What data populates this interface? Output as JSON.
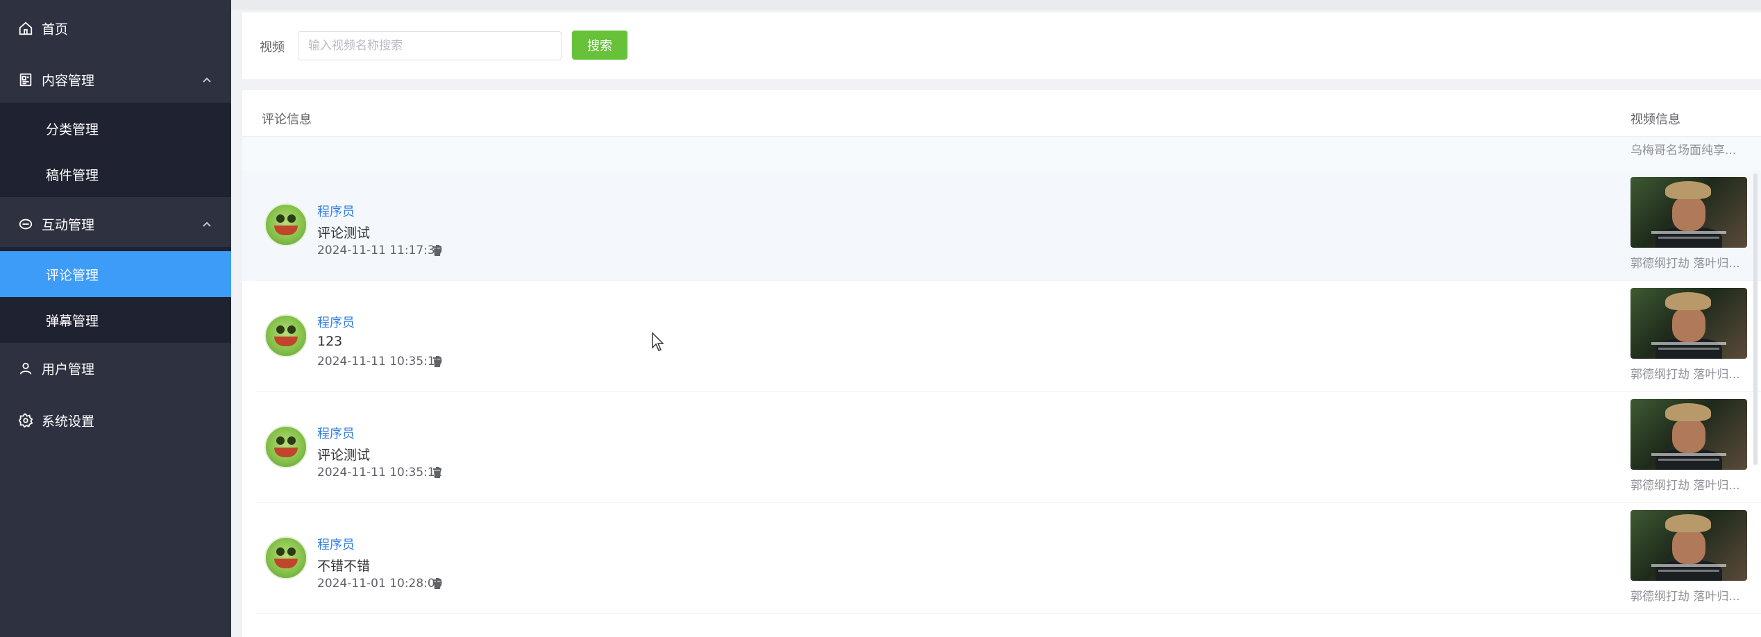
{
  "sidebar": {
    "items": [
      {
        "label": "首页",
        "icon": "home-icon"
      },
      {
        "label": "内容管理",
        "icon": "document-icon",
        "expanded": true
      },
      {
        "label": "分类管理"
      },
      {
        "label": "稿件管理"
      },
      {
        "label": "互动管理",
        "icon": "chat-icon",
        "expanded": true
      },
      {
        "label": "评论管理",
        "active": true
      },
      {
        "label": "弹幕管理"
      },
      {
        "label": "用户管理",
        "icon": "user-icon"
      },
      {
        "label": "系统设置",
        "icon": "gear-icon"
      }
    ]
  },
  "search": {
    "label": "视频",
    "placeholder": "输入视频名称搜索",
    "value": "",
    "button_label": "搜索"
  },
  "table": {
    "headers": {
      "comment": "评论信息",
      "video": "视频信息"
    },
    "partial_row_video_title": "乌梅哥名场面纯享...",
    "rows": [
      {
        "username": "程序员",
        "text": "评论测试",
        "date": "2024-11-11 11:17:39",
        "video_title": "郭德纲打劫 落叶归..."
      },
      {
        "username": "程序员",
        "text": "123",
        "date": "2024-11-11 10:35:19",
        "video_title": "郭德纲打劫 落叶归..."
      },
      {
        "username": "程序员",
        "text": "评论测试",
        "date": "2024-11-11 10:35:12",
        "video_title": "郭德纲打劫 落叶归..."
      },
      {
        "username": "程序员",
        "text": "不错不错",
        "date": "2024-11-01 10:28:00",
        "video_title": "郭德纲打劫 落叶归..."
      }
    ]
  },
  "colors": {
    "sidebar_bg": "#2d3140",
    "submenu_bg": "#1f2230",
    "active": "#3d9cf7",
    "search_button": "#67c23a",
    "username": "#2f7de1"
  }
}
